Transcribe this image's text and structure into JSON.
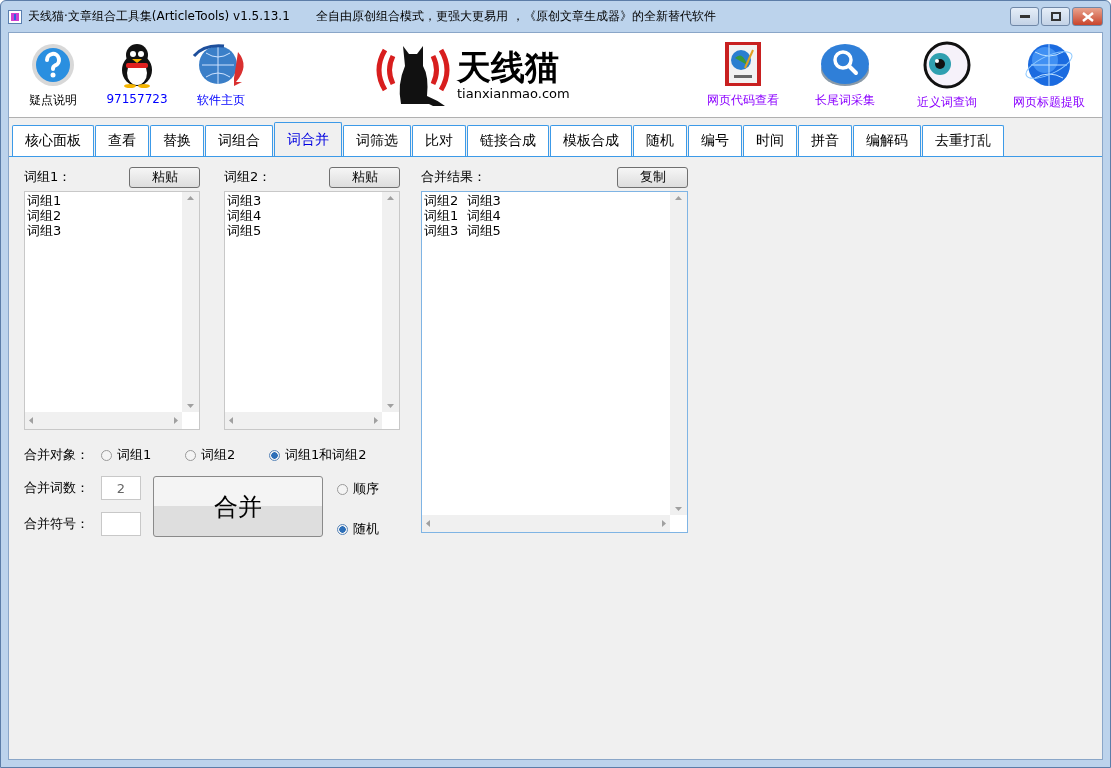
{
  "window": {
    "title": "天线猫·文章组合工具集(ArticleTools) v1.5.13.1",
    "subtitle": "全自由原创组合模式，更强大更易用 ，《原创文章生成器》的全新替代软件"
  },
  "toolbar_left": [
    {
      "kind": "help",
      "label": "疑点说明"
    },
    {
      "kind": "qq",
      "label": "97157723"
    },
    {
      "kind": "home",
      "label": "软件主页"
    }
  ],
  "logo": {
    "name": "天线猫",
    "domain": "tianxianmao.com"
  },
  "toolbar_right": [
    {
      "kind": "html",
      "label": "网页代码查看"
    },
    {
      "kind": "search",
      "label": "长尾词采集"
    },
    {
      "kind": "eye",
      "label": "近义词查询"
    },
    {
      "kind": "globe",
      "label": "网页标题提取"
    }
  ],
  "tabs": [
    {
      "label": "核心面板",
      "selected": false
    },
    {
      "label": "查看",
      "selected": false
    },
    {
      "label": "替换",
      "selected": false
    },
    {
      "label": "词组合",
      "selected": false
    },
    {
      "label": "词合并",
      "selected": true
    },
    {
      "label": "词筛选",
      "selected": false
    },
    {
      "label": "比对",
      "selected": false
    },
    {
      "label": "链接合成",
      "selected": false
    },
    {
      "label": "模板合成",
      "selected": false
    },
    {
      "label": "随机",
      "selected": false
    },
    {
      "label": "编号",
      "selected": false
    },
    {
      "label": "时间",
      "selected": false
    },
    {
      "label": "拼音",
      "selected": false
    },
    {
      "label": "编解码",
      "selected": false
    },
    {
      "label": "去重打乱",
      "selected": false
    }
  ],
  "group1": {
    "label": "词组1：",
    "button": "粘贴",
    "lines": [
      "词组1",
      "词组2",
      "词组3"
    ]
  },
  "group2": {
    "label": "词组2：",
    "button": "粘贴",
    "lines": [
      "词组3",
      "词组4",
      "词组5"
    ]
  },
  "result": {
    "label": "合并结果：",
    "button": "复制",
    "lines": [
      "词组2  词组3",
      "词组1  词组4",
      "词组3  词组5"
    ]
  },
  "merge_target": {
    "label": "合并对象：",
    "options": [
      {
        "label": "词组1",
        "selected": false
      },
      {
        "label": "词组2",
        "selected": false
      },
      {
        "label": "词组1和词组2",
        "selected": true
      }
    ]
  },
  "word_count": {
    "label": "合并词数：",
    "value": "2"
  },
  "separator": {
    "label": "合并符号："
  },
  "merge_button": "合并",
  "order": [
    {
      "label": "顺序",
      "selected": false
    },
    {
      "label": "随机",
      "selected": true
    }
  ]
}
